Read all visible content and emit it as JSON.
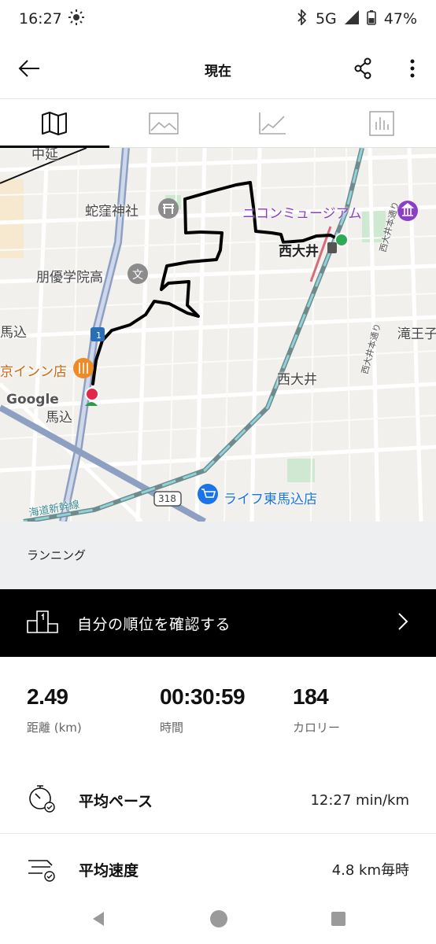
{
  "status": {
    "time": "16:27",
    "network": "5G",
    "battery": "47%"
  },
  "header": {
    "title": "現在"
  },
  "tabs": [
    {
      "name": "map",
      "icon": "map-icon",
      "active": true
    },
    {
      "name": "photos",
      "icon": "image-icon",
      "active": false
    },
    {
      "name": "graph",
      "icon": "line-chart-icon",
      "active": false
    },
    {
      "name": "splits",
      "icon": "bar-chart-icon",
      "active": false
    }
  ],
  "map": {
    "labels": {
      "nakanobu": "中延",
      "shrine": "蛇窪神社",
      "museum": "ニコンミュージアム",
      "station": "西大井",
      "school": "朋優学院高",
      "magome_left": "馬込",
      "restaurant": "京インン店",
      "google": "Google",
      "magome": "馬込",
      "nishioi": "西大井",
      "takiocho": "滝王子",
      "route": "318",
      "supermarket": "ライフ東馬込店",
      "shinkansen": "海道新幹線",
      "street1": "西大井本通り",
      "street2": "西大井本通り",
      "road1": "1"
    }
  },
  "activity": {
    "type": "ランニング"
  },
  "rank": {
    "label": "自分の順位を確認する"
  },
  "stats": {
    "distance_value": "2.49",
    "distance_label": "距離 (km)",
    "time_value": "00:30:59",
    "time_label": "時間",
    "calories_value": "184",
    "calories_label": "カロリー"
  },
  "metrics": {
    "pace_label": "平均ペース",
    "pace_value": "12:27 min/km",
    "speed_label": "平均速度",
    "speed_value": "4.8 km毎時"
  },
  "colors": {
    "route": "#000000",
    "start_marker": "#2eaa55",
    "end_marker": "#e0284a",
    "banner_bg": "#000000"
  }
}
